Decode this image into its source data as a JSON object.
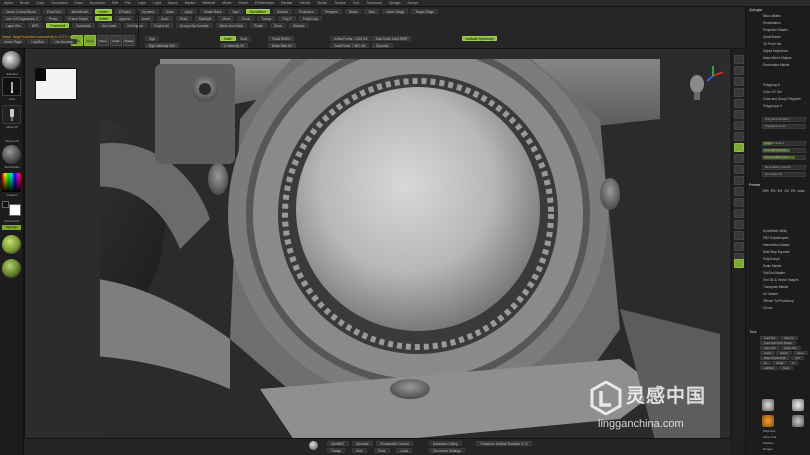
{
  "menu": [
    "Alpha",
    "Brush",
    "Color",
    "Document",
    "Draw",
    "Dynamics",
    "Edit",
    "File",
    "Layer",
    "Light",
    "Macro",
    "Marker",
    "Material",
    "Movie",
    "Picker",
    "Preferences",
    "Render",
    "Stencil",
    "Stroke",
    "Texture",
    "Tool",
    "Transform",
    "Zplugin",
    "Zscript"
  ],
  "shelf": {
    "row1": [
      "Home Control Brush",
      "FloorGrid",
      "MeshBrush",
      "Insert",
      "ZProject",
      "Dynamic",
      "Draw",
      "Apply",
      "Stroke Back",
      "Sym",
      "DynaMesh",
      "Smooth",
      "Projection",
      "Perspect",
      "Brush",
      "Solo",
      "Home Stage",
      "Target Stage"
    ],
    "row2": [
      "Use Kit Progression 3",
      "Persp",
      "Frame Model",
      "Select",
      "Append",
      "Insert",
      "Undo",
      "Redo",
      "Spotlight",
      "Mesh",
      "Ghost",
      "Transp",
      "Poly F",
      "PolyGroup"
    ],
    "row3": [
      "Layer Rev",
      "BPR",
      "Thumbnail",
      "Subdivide",
      "Del Lower",
      "Del Higher",
      "Project All",
      "Groups By Normals",
      "Mirror And Weld",
      "Polish",
      "Store",
      "Restore"
    ],
    "notice": "Morph Target Exported successfully to 10772 vertices",
    "tools": [
      "Edit",
      "Draw",
      "Move",
      "Scale",
      "Rotate"
    ],
    "rgb": "Rgb",
    "intensity": "Rgb Intensity 100",
    "zadd": "Zadd",
    "zsub": "Zsub",
    "zintensity": "Z Intensity 25",
    "focal_shift": "Focal Shift 0",
    "draw_size": "Draw Size 64",
    "active_points": "ActivePoints: 4,526 Mil",
    "total_points": "TotalPoints: 7,867 Mil",
    "max_zoom": "Max Undo Limit 9999",
    "dynamic": "Dynamic",
    "active_symmetry": "Activate Symmetry"
  },
  "left_tray": {
    "labels": [
      "Standard",
      "Dots",
      "Alpha Off",
      "Texture Off",
      "SkinShade4",
      "Gradient",
      "SwitchColor",
      "Alternate"
    ],
    "buttons": [
      "Home Page",
      "LightBox",
      "Live Boolean"
    ]
  },
  "bottom_bar": {
    "items": [
      "SpotMKT",
      "Transp",
      "Dynamic",
      "Perspective Control",
      "Backface Culling",
      "Solo",
      "Floor",
      "Local",
      "Document Settings",
      "Morph",
      "Solo Mode",
      "Draw Pointer",
      "Polyframe"
    ],
    "status": "Transform Subtool Rotation 0.75"
  },
  "right_palette": {
    "title": "Zplugin",
    "top_items": [
      "Misc Utilities",
      "Deactivation",
      "Projection Master",
      "QuickSketch",
      "3D Print Hub",
      "Adjust Keyframes",
      "Maya Blend Shapes",
      "Decimation Master"
    ],
    "sub_head": "Polygroup It",
    "sub_items": [
      "Polygroup It",
      "Color UV Set",
      "Color and Group Polypaint",
      "Polygroups It"
    ],
    "bars": [
      {
        "label": "Polypaint Content",
        "fill": 0.0
      },
      {
        "label": "Polypaint to UV",
        "fill": 0.0
      },
      {
        "label": "SubdivLevel 4",
        "fill": 0.2
      },
      {
        "label": "Tris 1979 74706",
        "fill": 0.65
      },
      {
        "label": "Points 2957 8711",
        "fill": 0.75
      },
      {
        "label": "Decimation Current",
        "fill": 0.0
      },
      {
        "label": "Decimate All",
        "fill": 0.0
      }
    ],
    "mid_head": "Presets",
    "presets": [
      "10%",
      "5%",
      "3%",
      "1%",
      "2%",
      "Auto"
    ],
    "list": [
      "DynaMesh Utility",
      "FBX ExportImport",
      "Intersection Master",
      "Multi Map Exporter",
      "PolyGroupIt",
      "Scale Master",
      "SubTool Master",
      "Text 3D & Vector Shapes",
      "Transpose Master",
      "UV Master",
      "ZBrush To Photoshop",
      "ZColor"
    ],
    "tool_head": "Tool",
    "tool_buttons": [
      "Load Tool",
      "Save As",
      "Load Tools From Project",
      "Copy Tool",
      "Paste Tool",
      "Import",
      "Export",
      "Clone",
      "Make PolyMesh3D",
      "GoZ",
      "All",
      "Visible",
      "R",
      "Lightbox",
      "Tools"
    ],
    "subtool_names": [
      "Polymesh",
      "Clone Tool",
      "ZSphere",
      "Merged"
    ]
  },
  "watermark": {
    "text": "灵感中国",
    "url": "lingganchina.com"
  },
  "colors": {
    "accent": "#8fbf3a",
    "notice": "#e0a030",
    "panel": "#1c1c1c",
    "canvas": "#2c2c2c"
  },
  "icons": [
    "circle-brush-icon",
    "stroke-icon",
    "alpha-icon",
    "material-sphere-icon",
    "color-picker-icon",
    "gizmo-axis-icon",
    "head-orientation-icon",
    "lightbox-logo-icon"
  ]
}
